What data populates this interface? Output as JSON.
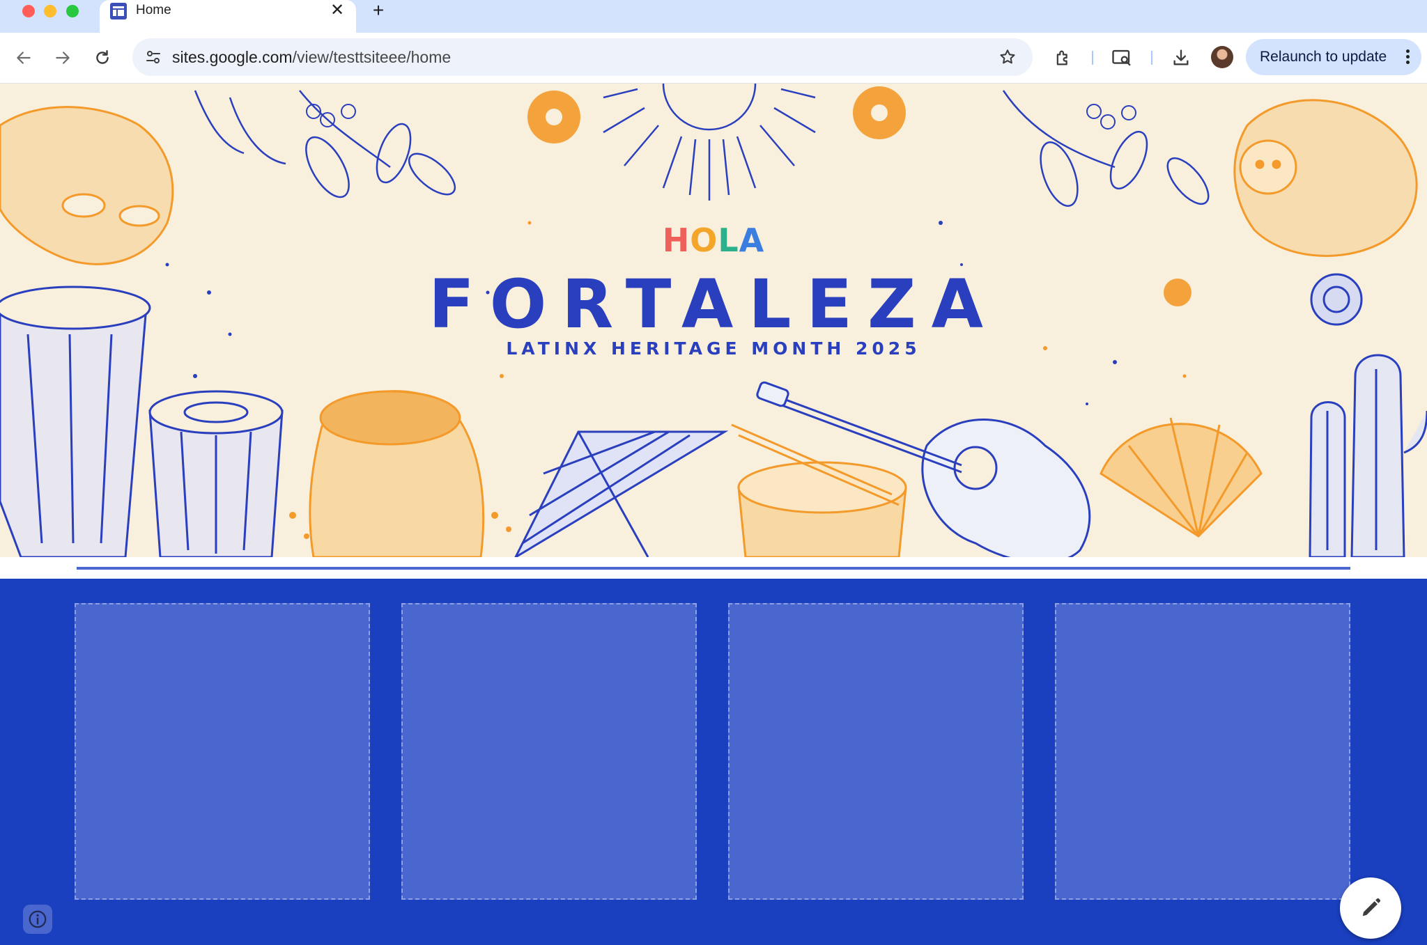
{
  "browser": {
    "tab": {
      "title": "Home",
      "close_glyph": "✕",
      "favicon": "google-sites-icon"
    },
    "new_tab_glyph": "+",
    "address": {
      "host": "sites.google.com",
      "path": "/view/testtsiteee/home"
    },
    "relaunch_label": "Relaunch to update"
  },
  "banner": {
    "hola_letters": [
      {
        "char": "H",
        "color": "#f0605a"
      },
      {
        "char": "O",
        "color": "#f4a62a"
      },
      {
        "char": "L",
        "color": "#2ab08a"
      },
      {
        "char": "A",
        "color": "#3a7ee0"
      }
    ],
    "title": "FORTALEZA",
    "subtitle": "LATINX HERITAGE MONTH 2025",
    "accent_blue": "#2a3fbe",
    "accent_orange": "#f39a2a"
  },
  "page": {
    "background": "#1a3fbf",
    "placeholder_color": "#4a66cf"
  }
}
